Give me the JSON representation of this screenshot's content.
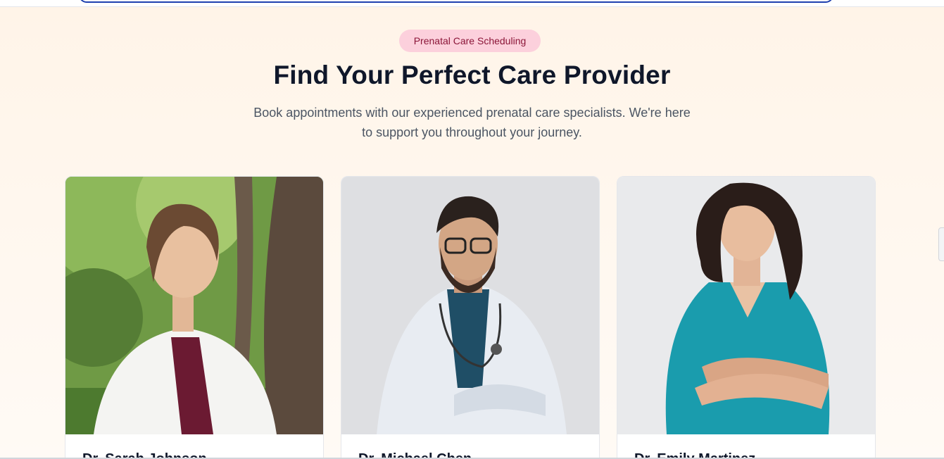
{
  "badge": "Prenatal Care Scheduling",
  "heading": "Find Your Perfect Care Provider",
  "subtitle_line1": "Book appointments with our experienced prenatal care specialists. We're here",
  "subtitle_line2": "to support you throughout your journey.",
  "colors": {
    "badge_bg": "#fcd0dc",
    "badge_text": "#8b1538",
    "page_bg": "#fff6ec",
    "scrubs": "#1a9cad"
  },
  "providers": [
    {
      "name": "Dr. Sarah Johnson",
      "photo": "female-doctor-white-coat-photo"
    },
    {
      "name": "Dr. Michael Chen",
      "photo": "male-doctor-stethoscope-photo"
    },
    {
      "name": "Dr. Emily Martinez",
      "photo": "female-doctor-teal-scrubs-photo"
    }
  ]
}
